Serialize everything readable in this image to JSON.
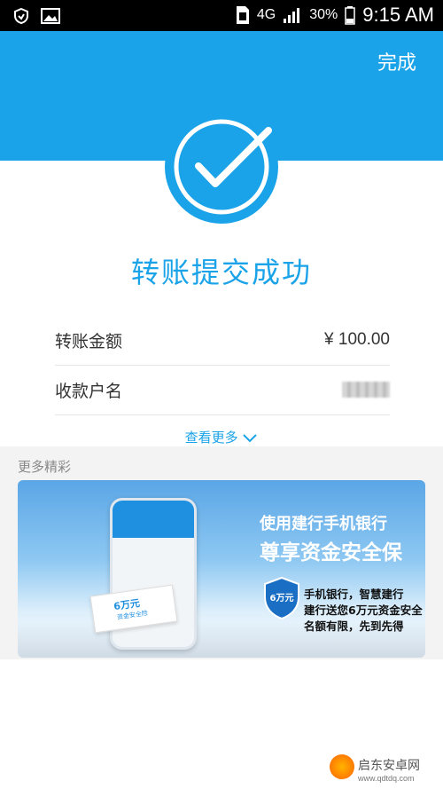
{
  "status_bar": {
    "network": "4G",
    "battery": "30%",
    "time": "9:15 AM"
  },
  "header": {
    "done_label": "完成"
  },
  "result": {
    "title": "转账提交成功"
  },
  "details": {
    "amount_label": "转账金额",
    "amount_value": "¥ 100.00",
    "payee_label": "收款户名"
  },
  "view_more": "查看更多",
  "more_section": {
    "label": "更多精彩",
    "banner": {
      "headline1": "使用建行手机银行",
      "headline2": "尊享资金安全保",
      "line1": "手机银行，智慧建行",
      "line2": "建行送您6万元资金安全",
      "line3": "名额有限，先到先得",
      "badge": "6万元",
      "badge_sub": "资金安全险",
      "shield_text": "6万元"
    }
  },
  "watermark": {
    "text": "启东安卓网",
    "sub": "www.qdtdq.com"
  },
  "colors": {
    "accent": "#1aa3e8"
  }
}
